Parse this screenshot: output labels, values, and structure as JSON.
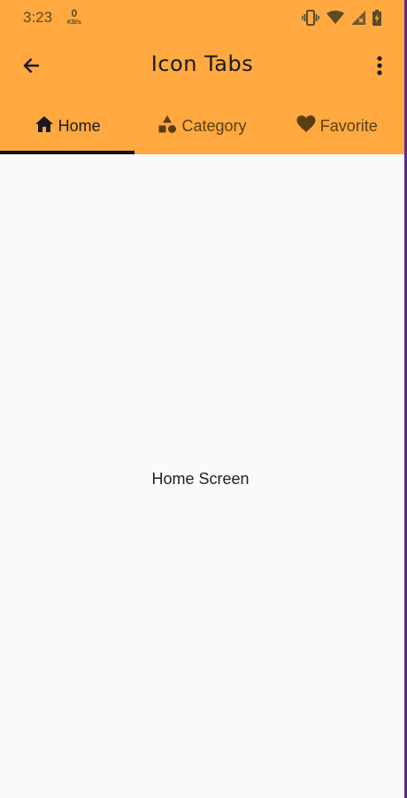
{
  "status_bar": {
    "time": "3:23",
    "net_speed_value": "0",
    "net_speed_unit": "KB/s",
    "icons": [
      "vibrate-icon",
      "wifi-icon",
      "signal-icon",
      "battery-icon"
    ]
  },
  "app_bar": {
    "title": "Icon Tabs",
    "back_icon": "arrow-back-icon",
    "menu_icon": "more-vert-icon"
  },
  "tabs": [
    {
      "label": "Home",
      "icon": "home-icon",
      "selected": true
    },
    {
      "label": "Category",
      "icon": "category-icon",
      "selected": false
    },
    {
      "label": "Favorite",
      "icon": "heart-icon",
      "selected": false
    }
  ],
  "content": {
    "text": "Home Screen"
  },
  "colors": {
    "app_bar": "#ffa940",
    "indicator": "#111111",
    "background": "#fafafa"
  }
}
